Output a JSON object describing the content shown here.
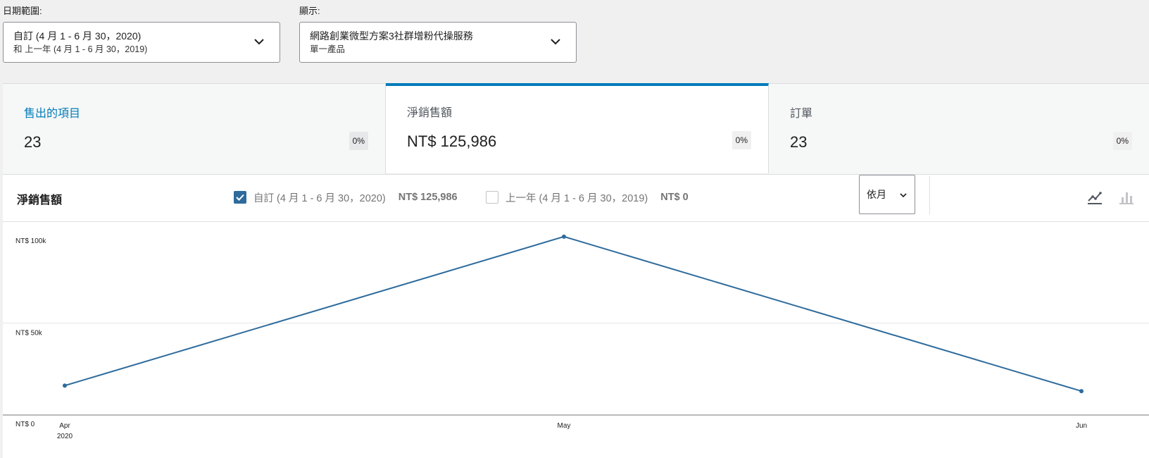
{
  "filters": {
    "date_range": {
      "label": "日期範圍:",
      "primary": "自訂 (4 月 1 - 6 月 30，2020)",
      "secondary": "和 上一年 (4 月 1 - 6 月 30，2019)"
    },
    "show": {
      "label": "顯示:",
      "primary": "網路創業微型方案3社群增粉代操服務",
      "secondary": "單一產品"
    }
  },
  "summary": [
    {
      "label": "售出的項目",
      "value": "23",
      "change": "0%"
    },
    {
      "label": "淨銷售額",
      "value": "NT$ 125,986",
      "change": "0%"
    },
    {
      "label": "訂單",
      "value": "23",
      "change": "0%"
    }
  ],
  "chart_panel": {
    "title": "淨銷售額",
    "legend": [
      {
        "label": "自訂 (4 月 1 - 6 月 30，2020)",
        "total": "NT$ 125,986",
        "checked": true,
        "color": "#2e6b9c"
      },
      {
        "label": "上一年 (4 月 1 - 6 月 30，2019)",
        "total": "NT$ 0",
        "checked": false
      }
    ],
    "interval": "依月",
    "chart_type_icons": [
      "line-chart-icon",
      "bar-chart-icon"
    ]
  },
  "chart_data": {
    "type": "line",
    "x": [
      "Apr",
      "May",
      "Jun"
    ],
    "x_sublabels": [
      "2020",
      "",
      ""
    ],
    "series": [
      {
        "name": "自訂 (4 月 1 - 6 月 30，2020)",
        "values": [
          16000,
          97000,
          13000
        ],
        "color": "#2e6b9c"
      }
    ],
    "y_ticks": [
      {
        "value": 0,
        "label": "NT$ 0"
      },
      {
        "value": 50000,
        "label": "NT$ 50k"
      },
      {
        "value": 100000,
        "label": "NT$ 100k"
      }
    ],
    "ylim": [
      0,
      100000
    ],
    "grid": true
  }
}
